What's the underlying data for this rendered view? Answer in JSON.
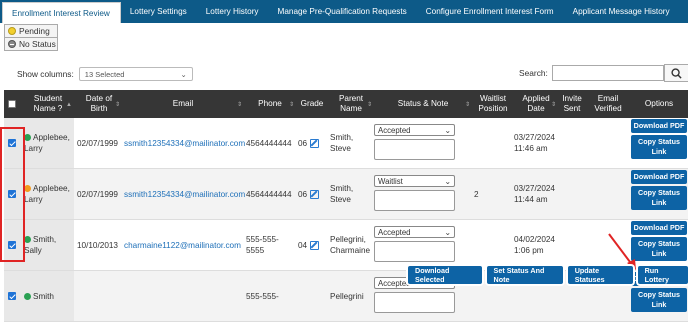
{
  "tabs": [
    "Enrollment Interest Review",
    "Lottery Settings",
    "Lottery History",
    "Manage Pre-Qualification Requests",
    "Configure Enrollment Interest Form",
    "Applicant Message History"
  ],
  "legend": {
    "pending": "Pending",
    "no_status": "No Status"
  },
  "show_columns": {
    "label": "Show columns:",
    "value": "13 Selected"
  },
  "search": {
    "label": "Search:"
  },
  "headers": {
    "student": "Student Name ?",
    "dob": "Date of Birth",
    "email": "Email",
    "phone": "Phone",
    "grade": "Grade",
    "parent": "Parent Name",
    "status": "Status & Note",
    "waitlist": "Waitlist Position",
    "applied": "Applied Date",
    "invite": "Invite Sent",
    "verified": "Email Verified",
    "options": "Options"
  },
  "rows": [
    {
      "name1": "Applebee,",
      "name2": "Larry",
      "dot": "green",
      "dob": "02/07/1999",
      "email": "ssmith12354334@mailinator.com",
      "phone1": "4564444444",
      "phone2": "",
      "grade": "06",
      "parent1": "Smith,",
      "parent2": "Steve",
      "status": "Accepted",
      "waitlist": "",
      "applied1": "03/27/2024",
      "applied2": "11:46 am"
    },
    {
      "name1": "Applebee,",
      "name2": "Larry",
      "dot": "orange",
      "dob": "02/07/1999",
      "email": "ssmith12354334@mailinator.com",
      "phone1": "4564444444",
      "phone2": "",
      "grade": "06",
      "parent1": "Smith,",
      "parent2": "Steve",
      "status": "Waitlist",
      "waitlist": "2",
      "applied1": "03/27/2024",
      "applied2": "11:44 am"
    },
    {
      "name1": "Smith,",
      "name2": "Sally",
      "dot": "green",
      "dob": "10/10/2013",
      "email": "charmaine1122@mailinator.com",
      "phone1": "555-555-",
      "phone2": "5555",
      "grade": "04",
      "parent1": "Pellegrini,",
      "parent2": "Charmaine",
      "status": "Accepted",
      "waitlist": "",
      "applied1": "04/02/2024",
      "applied2": "1:06 pm"
    },
    {
      "name1": "Smith",
      "name2": "",
      "dot": "green",
      "dob": "",
      "email": "",
      "phone1": "555-555-",
      "phone2": "",
      "grade": "",
      "parent1": "Pellegrini",
      "parent2": "",
      "status": "Accepted",
      "waitlist": "",
      "applied1": "",
      "applied2": ""
    }
  ],
  "row_buttons": {
    "download_pdf": "Download PDF",
    "copy_status": "Copy Status",
    "copy_status2": "Link"
  },
  "footer": {
    "download_selected": "Download Selected",
    "set_status": "Set Status And Note",
    "update_statuses": "Update Statuses",
    "run_lottery": "Run Lottery"
  },
  "colors": {
    "nav": "#0d5a88",
    "header": "#363636",
    "button": "#0d63a5",
    "highlight": "#e02424"
  }
}
